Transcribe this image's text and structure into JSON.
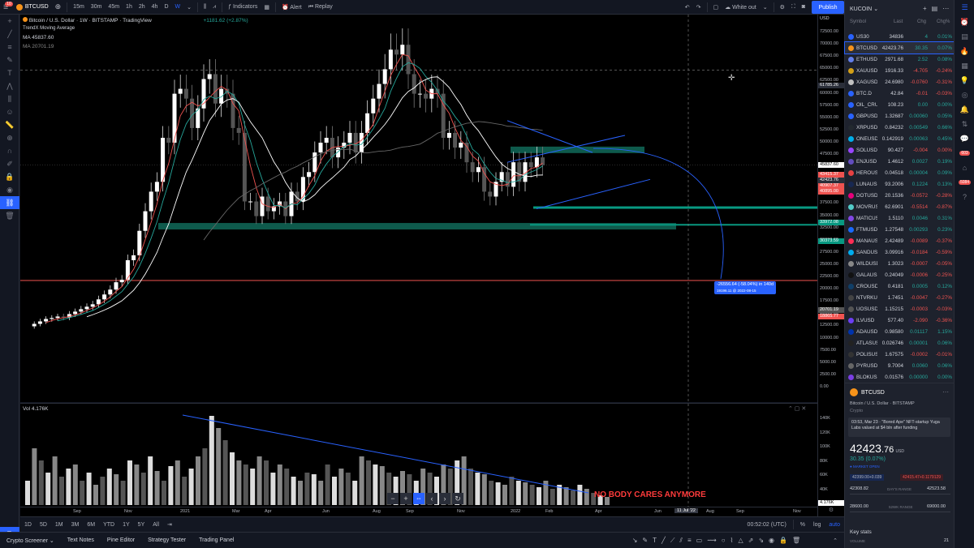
{
  "toolbar": {
    "symbol": "BTCUSD",
    "intervals": [
      "15m",
      "30m",
      "45m",
      "1h",
      "2h",
      "4h",
      "D",
      "W"
    ],
    "active_interval": "W",
    "indicators": "Indicators",
    "alert": "Alert",
    "replay": "Replay",
    "theme": "White out",
    "publish": "Publish",
    "notif_badge": "10"
  },
  "legend": {
    "title": "Bitcoin / U.S. Dollar",
    "interval": "1W",
    "exchange": "BITSTAMP",
    "source": "TradingView",
    "change": "+1181.62 (+2.87%)",
    "indicator": "TrendX Moving Average",
    "ma1_label": "MA",
    "ma1_value": "45837.60",
    "ma2_label": "MA",
    "ma2_value": "20701.19",
    "vol_label": "Vol",
    "vol_value": "4.176K"
  },
  "yaxis": {
    "currency": "USD",
    "labels": [
      "72500.00",
      "70000.00",
      "67500.00",
      "65000.00",
      "62500.00",
      "60000.00",
      "57500.00",
      "55000.00",
      "52500.00",
      "50000.00",
      "47500.00",
      "45000.00",
      "42500.00",
      "40000.00",
      "37500.00",
      "35000.00",
      "32500.00",
      "30000.00",
      "27500.00",
      "25000.00",
      "22500.00",
      "20000.00",
      "17500.00",
      "15000.00",
      "12500.00",
      "10000.00",
      "7500.00",
      "5000.00",
      "2500.00",
      "0.00"
    ],
    "price_tags": [
      {
        "text": "61785.26",
        "color": "#2a2e39"
      },
      {
        "text": "45837.60",
        "color": "#ffffff",
        "fg": "#000"
      },
      {
        "text": "43415.37",
        "color": "#ef5350"
      },
      {
        "text": "42423.76",
        "color": "#2a2e39"
      },
      {
        "text": "40907.37",
        "color": "#ef5350"
      },
      {
        "text": "40895.00",
        "color": "#ef5350"
      },
      {
        "text": "33972.08",
        "color": "#089981"
      },
      {
        "text": "30373.59",
        "color": "#089981"
      },
      {
        "text": "20701.19",
        "color": "#555"
      },
      {
        "text": "18865.77",
        "color": "#ef5350"
      }
    ],
    "vol_labels": [
      "140K",
      "120K",
      "100K",
      "80K",
      "60K",
      "40K",
      "20K"
    ],
    "vol_tag": "4.176K"
  },
  "xaxis": {
    "labels": [
      "Sep",
      "Nov",
      "2021",
      "Mar",
      "Apr",
      "Jun",
      "Aug",
      "Sep",
      "Nov",
      "2022",
      "Feb",
      "Apr",
      "Jun",
      "Aug",
      "Sep",
      "Nov"
    ],
    "crosshair": "11 Jul '22"
  },
  "annotation": {
    "measure": "-26556.64 (-58.04%) in 140d",
    "measure_sub": "19196.11 @ 2022-08-15",
    "note": "NO BODY CARES ANYMORE"
  },
  "bottombar": {
    "ranges": [
      "1D",
      "5D",
      "1M",
      "3M",
      "6M",
      "YTD",
      "1Y",
      "5Y",
      "All"
    ],
    "time": "00:52:02 (UTC)",
    "percent": "%",
    "log": "log",
    "auto": "auto"
  },
  "bottomtabs": [
    "Crypto Screener",
    "Text Notes",
    "Pine Editor",
    "Strategy Tester",
    "Trading Panel"
  ],
  "watchlist": {
    "name": "KUCOIN",
    "headers": [
      "Symbol",
      "Last",
      "Chg",
      "Chg%"
    ],
    "rows": [
      {
        "sym": "US30",
        "last": "34836",
        "chg": "4",
        "pct": "0.01%",
        "dir": "up",
        "color": "#2962ff"
      },
      {
        "sym": "BTCUSD",
        "last": "42423.76",
        "chg": "30.35",
        "pct": "0.07%",
        "dir": "up",
        "color": "#f7931a",
        "selected": true
      },
      {
        "sym": "ETHUSD",
        "last": "2971.68",
        "chg": "2.52",
        "pct": "0.08%",
        "dir": "up",
        "color": "#627eea"
      },
      {
        "sym": "XAUUSD",
        "last": "1916.33",
        "chg": "-4.705",
        "pct": "-0.24%",
        "dir": "dn",
        "color": "#d4a017"
      },
      {
        "sym": "XAGUSD",
        "last": "24.6980",
        "chg": "-0.0760",
        "pct": "-0.31%",
        "dir": "dn",
        "color": "#c0c0c0"
      },
      {
        "sym": "BTC.D",
        "last": "42.84",
        "chg": "-0.01",
        "pct": "-0.03%",
        "dir": "dn",
        "color": "#2962ff"
      },
      {
        "sym": "OIL_CRUDE",
        "last": "108.23",
        "chg": "0.00",
        "pct": "0.00%",
        "dir": "up",
        "color": "#2962ff"
      },
      {
        "sym": "GBPUSD",
        "last": "1.32687",
        "chg": "0.00060",
        "pct": "0.05%",
        "dir": "up",
        "color": "#2962ff"
      },
      {
        "sym": "XRPUSD",
        "last": "0.84232",
        "chg": "0.00549",
        "pct": "0.66%",
        "dir": "up",
        "color": "#23292f"
      },
      {
        "sym": "ONEUSD",
        "last": "0.142919",
        "chg": "0.00063",
        "pct": "0.45%",
        "dir": "up",
        "color": "#00aee9"
      },
      {
        "sym": "SOLUSD",
        "last": "90.427",
        "chg": "-0.004",
        "pct": "0.00%",
        "dir": "dn",
        "color": "#9945ff"
      },
      {
        "sym": "ENJUSD",
        "last": "1.4612",
        "chg": "0.0027",
        "pct": "0.19%",
        "dir": "up",
        "color": "#624dbf"
      },
      {
        "sym": "HEROUSD",
        "last": "0.04518",
        "chg": "0.00004",
        "pct": "0.09%",
        "dir": "up",
        "color": "#e84142"
      },
      {
        "sym": "LUNAUSD",
        "last": "93.2006",
        "chg": "0.1224",
        "pct": "0.13%",
        "dir": "up",
        "color": "#172852"
      },
      {
        "sym": "DOTUSD",
        "last": "20.1536",
        "chg": "-0.0572",
        "pct": "-0.28%",
        "dir": "dn",
        "color": "#e6007a"
      },
      {
        "sym": "MOVRUSD",
        "last": "62.6901",
        "chg": "-0.5514",
        "pct": "-0.87%",
        "dir": "dn",
        "color": "#53cbc8"
      },
      {
        "sym": "MATICUSD",
        "last": "1.5110",
        "chg": "0.0046",
        "pct": "0.31%",
        "dir": "up",
        "color": "#8247e5"
      },
      {
        "sym": "FTMUSD",
        "last": "1.27548",
        "chg": "0.00293",
        "pct": "0.23%",
        "dir": "up",
        "color": "#1969ff"
      },
      {
        "sym": "MANAUSD",
        "last": "2.42489",
        "chg": "-0.0089",
        "pct": "-0.37%",
        "dir": "dn",
        "color": "#ff2d55"
      },
      {
        "sym": "SANDUSD",
        "last": "3.09916",
        "chg": "-0.0184",
        "pct": "-0.59%",
        "dir": "dn",
        "color": "#00adef"
      },
      {
        "sym": "WILDUSD",
        "last": "1.3023",
        "chg": "-0.0007",
        "pct": "-0.05%",
        "dir": "dn",
        "color": "#888"
      },
      {
        "sym": "GALAUSD",
        "last": "0.24049",
        "chg": "-0.0006",
        "pct": "-0.25%",
        "dir": "dn",
        "color": "#111"
      },
      {
        "sym": "CROUSD",
        "last": "0.4181",
        "chg": "0.0005",
        "pct": "0.12%",
        "dir": "up",
        "color": "#103f68"
      },
      {
        "sym": "NTVRKUSD",
        "last": "1.7451",
        "chg": "-0.0047",
        "pct": "-0.27%",
        "dir": "dn",
        "color": "#444"
      },
      {
        "sym": "UOSUSD",
        "last": "1.15215",
        "chg": "-0.0003",
        "pct": "-0.03%",
        "dir": "dn",
        "color": "#555"
      },
      {
        "sym": "ILVUSD",
        "last": "577.40",
        "chg": "-2.090",
        "pct": "-0.36%",
        "dir": "dn",
        "color": "#6c3ef4"
      },
      {
        "sym": "ADAUSD",
        "last": "0.98580",
        "chg": "0.01117",
        "pct": "1.15%",
        "dir": "up",
        "color": "#0033ad"
      },
      {
        "sym": "ATLASUSD",
        "last": "0.026746",
        "chg": "0.00001",
        "pct": "0.06%",
        "dir": "up",
        "color": "#222"
      },
      {
        "sym": "POLISUSD",
        "last": "1.67575",
        "chg": "-0.0002",
        "pct": "-0.01%",
        "dir": "dn",
        "color": "#333"
      },
      {
        "sym": "PYRUSD",
        "last": "9.7004",
        "chg": "0.0060",
        "pct": "0.06%",
        "dir": "up",
        "color": "#666"
      },
      {
        "sym": "BLOKUSD",
        "last": "0.01576",
        "chg": "0.00000",
        "pct": "0.00%",
        "dir": "up",
        "color": "#7b3fe4"
      }
    ]
  },
  "details": {
    "symbol": "BTCUSD",
    "name": "Bitcoin / U.S. Dollar",
    "exchange": "BITSTAMP",
    "category": "Crypto",
    "news": "03:53, Mar 23 · \"Bored Ape\" NFT-startup Yuga Labs valued at $4 bln after funding",
    "price_main": "42423",
    "price_dec": ".76",
    "currency": "USD",
    "change": "30.35 (0.07%)",
    "status": "MARKET OPEN",
    "bid": "42399.00+0.039",
    "ask": "42415.47+0.1179129",
    "day_low": "42308.82",
    "day_label": "DAY'S RANGE",
    "day_high": "42523.58",
    "week_low": "28600.00",
    "week_label": "52WK RANGE",
    "week_high": "69000.00",
    "key_stats": "Key stats",
    "volume_label": "VOLUME",
    "volume_value": "21"
  },
  "rightbar": {
    "badge1": "603",
    "badge2": "5084"
  }
}
